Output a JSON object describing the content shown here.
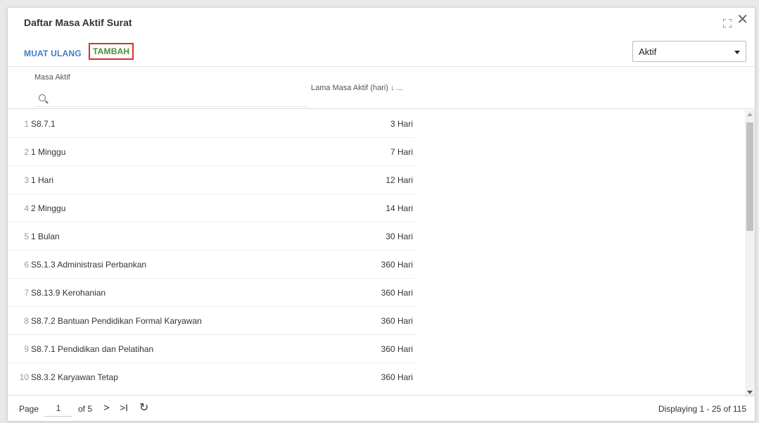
{
  "window": {
    "title": "Daftar Masa Aktif Surat"
  },
  "toolbar": {
    "reload_label": "MUAT ULANG",
    "add_label": "TAMBAH",
    "filter_value": "Aktif"
  },
  "columns": {
    "name_header": "Masa Aktif",
    "duration_header": "Lama Masa Aktif (hari) ↓ ..."
  },
  "rows": [
    {
      "num": "1",
      "name": "S8.7.1",
      "value": "3 Hari"
    },
    {
      "num": "2",
      "name": "1 Minggu",
      "value": "7 Hari"
    },
    {
      "num": "3",
      "name": "1 Hari",
      "value": "12 Hari"
    },
    {
      "num": "4",
      "name": "2 Minggu",
      "value": "14 Hari"
    },
    {
      "num": "5",
      "name": "1 Bulan",
      "value": "30 Hari"
    },
    {
      "num": "6",
      "name": "S5.1.3 Administrasi Perbankan",
      "value": "360 Hari"
    },
    {
      "num": "7",
      "name": "S8.13.9 Kerohanian",
      "value": "360 Hari"
    },
    {
      "num": "8",
      "name": "S8.7.2 Bantuan Pendidikan Formal Karyawan",
      "value": "360 Hari"
    },
    {
      "num": "9",
      "name": "S8.7.1 Pendidikan dan Pelatihan",
      "value": "360 Hari"
    },
    {
      "num": "10",
      "name": "S8.3.2 Karyawan Tetap",
      "value": "360 Hari"
    }
  ],
  "pager": {
    "page_label": "Page",
    "page_value": "1",
    "of_label": "of 5",
    "next_glyph": ">",
    "last_glyph": ">I",
    "refresh_glyph": "↻",
    "display_text": "Displaying 1 - 25 of 115"
  }
}
